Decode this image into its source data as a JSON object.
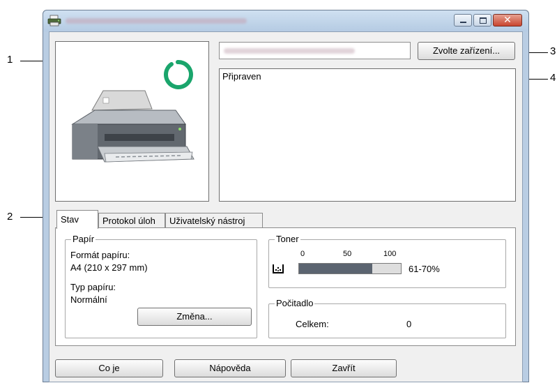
{
  "callouts": [
    "1",
    "2",
    "3",
    "4"
  ],
  "window": {
    "title_obscured": true,
    "controls": [
      "minimize-icon",
      "maximize-icon",
      "close-icon"
    ],
    "close_glyph": "✕"
  },
  "device": {
    "selected_obscured": true,
    "select_button": "Zvolte zařízení..."
  },
  "status": {
    "message": "Připraven"
  },
  "tabs": [
    {
      "label": "Stav",
      "active": true
    },
    {
      "label": "Protokol úloh",
      "active": false
    },
    {
      "label": "Uživatelský nástroj",
      "active": false
    }
  ],
  "paper": {
    "group_title": "Papír",
    "format_label": "Formát papíru:",
    "format_value": "A4 (210 x 297 mm)",
    "type_label": "Typ papíru:",
    "type_value": "Normální",
    "change_button": "Změna..."
  },
  "toner": {
    "group_title": "Toner",
    "scale": [
      "0",
      "50",
      "100"
    ],
    "level_fraction": 0.72,
    "level_text": "61-70%",
    "fill_color": "#5b6470"
  },
  "counter": {
    "group_title": "Počitadlo",
    "total_label": "Celkem:",
    "total_value": "0"
  },
  "buttons": {
    "whats_this": "Co je",
    "help": "Nápověda",
    "close": "Zavřít"
  },
  "colors": {
    "ready_indicator": "#1aa56c"
  }
}
